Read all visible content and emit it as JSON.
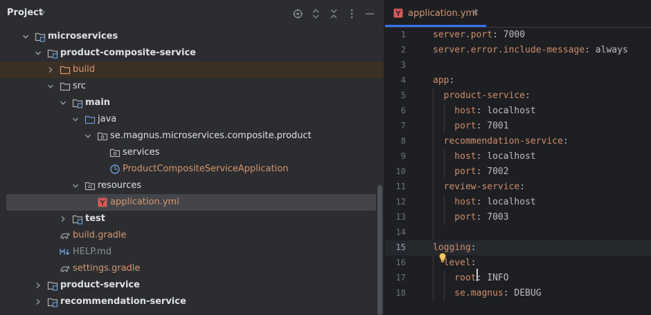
{
  "panel": {
    "title": "Project",
    "header_icons": [
      "locate-icon",
      "expand-all-icon",
      "collapse-all-icon",
      "options-icon",
      "minimize-icon"
    ]
  },
  "tree": [
    {
      "label": "microservices",
      "icon": "module-folder-icon",
      "expanded": true,
      "bold": true,
      "color": "#dfe1e5"
    },
    {
      "label": "product-composite-service",
      "icon": "module-folder-icon",
      "expanded": true,
      "bold": true,
      "color": "#dfe1e5"
    },
    {
      "label": "build",
      "icon": "excluded-folder-icon",
      "expanded": false,
      "bold": false,
      "color": "#d7966f"
    },
    {
      "label": "src",
      "icon": "folder-icon",
      "expanded": true,
      "bold": false,
      "color": "#dfe1e5"
    },
    {
      "label": "main",
      "icon": "module-folder-icon",
      "expanded": true,
      "bold": true,
      "color": "#dfe1e5"
    },
    {
      "label": "java",
      "icon": "source-folder-icon",
      "expanded": true,
      "bold": false,
      "color": "#dfe1e5"
    },
    {
      "label": "se.magnus.microservices.composite.product",
      "icon": "package-icon",
      "expanded": true,
      "bold": false,
      "color": "#dfe1e5"
    },
    {
      "label": "services",
      "icon": "package-icon",
      "bold": false,
      "color": "#dfe1e5"
    },
    {
      "label": "ProductCompositeServiceApplication",
      "icon": "spring-boot-class-icon",
      "bold": false,
      "color": "#d7966f"
    },
    {
      "label": "resources",
      "icon": "resources-folder-icon",
      "expanded": true,
      "bold": false,
      "color": "#dfe1e5"
    },
    {
      "label": "application.yml",
      "icon": "yaml-file-icon",
      "bold": false,
      "color": "#d7966f",
      "selected": true
    },
    {
      "label": "test",
      "icon": "module-folder-icon",
      "expanded": false,
      "bold": true,
      "color": "#dfe1e5"
    },
    {
      "label": "build.gradle",
      "icon": "gradle-icon",
      "bold": false,
      "color": "#d7966f"
    },
    {
      "label": "HELP.md",
      "icon": "markdown-icon",
      "bold": false,
      "color": "#8c8f94"
    },
    {
      "label": "settings.gradle",
      "icon": "gradle-icon",
      "bold": false,
      "color": "#d7966f"
    },
    {
      "label": "product-service",
      "icon": "module-folder-icon",
      "expanded": false,
      "bold": true,
      "color": "#dfe1e5"
    },
    {
      "label": "recommendation-service",
      "icon": "module-folder-icon",
      "expanded": false,
      "bold": true,
      "color": "#dfe1e5"
    }
  ],
  "editor": {
    "tab": {
      "label": "application.yml",
      "icon": "yaml-file-icon",
      "close": "×"
    },
    "current_line": 15,
    "lines": [
      {
        "num": "1",
        "key": "server.port",
        "rest": ": 7000"
      },
      {
        "num": "2",
        "key": "server.error.include-message",
        "rest": ": always"
      },
      {
        "num": "3",
        "key": "",
        "rest": ""
      },
      {
        "num": "4",
        "key": "app",
        "rest": ":"
      },
      {
        "num": "5",
        "key": "  product-service",
        "rest": ":"
      },
      {
        "num": "6",
        "key": "    host",
        "rest": ": localhost"
      },
      {
        "num": "7",
        "key": "    port",
        "rest": ": 7001"
      },
      {
        "num": "8",
        "key": "  recommendation-service",
        "rest": ":"
      },
      {
        "num": "9",
        "key": "    host",
        "rest": ": localhost"
      },
      {
        "num": "10",
        "key": "    port",
        "rest": ": 7002"
      },
      {
        "num": "11",
        "key": "  review-service",
        "rest": ":"
      },
      {
        "num": "12",
        "key": "    host",
        "rest": ": localhost"
      },
      {
        "num": "13",
        "key": "    port",
        "rest": ": 7003"
      },
      {
        "num": "14",
        "key": "",
        "rest": ""
      },
      {
        "num": "15",
        "key": "logging",
        "rest": ":"
      },
      {
        "num": "16",
        "key": "  level",
        "rest": ":"
      },
      {
        "num": "17",
        "key": "    root",
        "rest": ": INFO"
      },
      {
        "num": "18",
        "key": "    se.magnus",
        "rest": ": DEBUG"
      }
    ]
  }
}
